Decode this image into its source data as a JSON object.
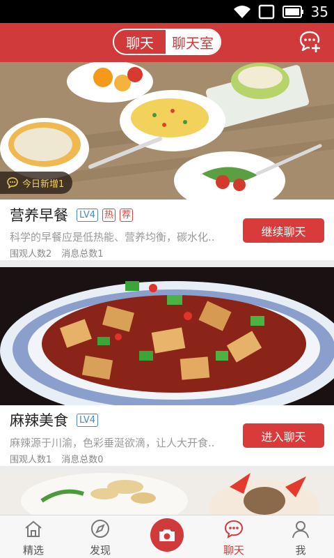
{
  "status_bar": {
    "time": "35",
    "icons": [
      "wifi-icon",
      "screen-icon",
      "battery-icon"
    ]
  },
  "header": {
    "tabs": [
      {
        "label": "聊天"
      },
      {
        "label": "聊天室"
      }
    ],
    "active_tab": "聊天室",
    "action_icon": "add-chat-icon"
  },
  "rooms": [
    {
      "badge": "今日新增1",
      "title": "营养早餐",
      "level": "LV4",
      "tags": [
        "热",
        "荐"
      ],
      "description": "科学的早餐应是低热能、营养均衡，碳水化..",
      "viewers": "围观人数2",
      "messages": "消息总数1",
      "button": "继续聊天"
    },
    {
      "title": "麻辣美食",
      "level": "LV4",
      "description": "麻辣源于川渝，色彩垂涎欲滴，让人大开食..",
      "viewers": "围观人数1",
      "messages": "消息总数0",
      "button": "进入聊天"
    }
  ],
  "bottom_nav": [
    {
      "label": "精选",
      "icon": "home-icon"
    },
    {
      "label": "发现",
      "icon": "compass-icon"
    },
    {
      "label": "",
      "icon": "camera-icon"
    },
    {
      "label": "聊天",
      "icon": "chat-icon"
    },
    {
      "label": "我",
      "icon": "person-icon"
    }
  ],
  "colors": {
    "accent": "#d13a3a",
    "level": "#4a86c9",
    "badge_text": "#f4d25a"
  }
}
